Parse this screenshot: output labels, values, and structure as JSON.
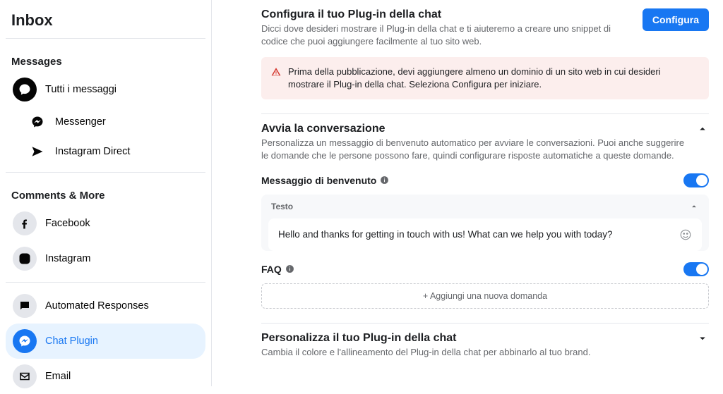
{
  "sidebar": {
    "title": "Inbox",
    "messages_label": "Messages",
    "comments_label": "Comments & More",
    "items": {
      "all": "Tutti i messaggi",
      "messenger": "Messenger",
      "instagram_direct": "Instagram Direct",
      "facebook": "Facebook",
      "instagram": "Instagram",
      "automated": "Automated Responses",
      "chat_plugin": "Chat Plugin",
      "email": "Email"
    }
  },
  "configure": {
    "title": "Configura il tuo Plug-in della chat",
    "sub": "Dicci dove desideri mostrare il Plug-in della chat e ti aiuteremo a creare uno snippet di codice che puoi aggiungere facilmente al tuo sito web.",
    "button": "Configura",
    "alert": "Prima della pubblicazione, devi aggiungere almeno un dominio di un sito web in cui desideri mostrare il Plug-in della chat. Seleziona Configura per iniziare."
  },
  "start": {
    "title": "Avvia la conversazione",
    "sub": "Personalizza un messaggio di benvenuto automatico per avviare le conversazioni. Puoi anche suggerire le domande che le persone possono fare, quindi configurare risposte automatiche a queste domande.",
    "welcome_label": "Messaggio di benvenuto",
    "text_label": "Testo",
    "welcome_text": "Hello and thanks for getting in touch with us! What can we help you with today?",
    "faq_label": "FAQ",
    "add_question": "+ Aggiungi una nuova domanda"
  },
  "customize": {
    "title": "Personalizza il tuo Plug-in della chat",
    "sub": "Cambia il colore e l'allineamento del Plug-in della chat per abbinarlo al tuo brand."
  }
}
